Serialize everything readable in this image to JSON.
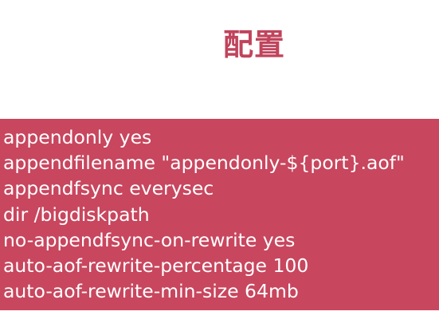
{
  "title": "配置",
  "config_lines": [
    "appendonly yes",
    "appendfilename \"appendonly-${port}.aof\"",
    "appendfsync everysec",
    "dir /bigdiskpath",
    "no-appendfsync-on-rewrite yes",
    "auto-aof-rewrite-percentage 100",
    "auto-aof-rewrite-min-size 64mb"
  ],
  "colors": {
    "title": "#c0445c",
    "panel_background": "#c8465e",
    "panel_text": "#ffffff",
    "page_background": "#ffffff"
  }
}
